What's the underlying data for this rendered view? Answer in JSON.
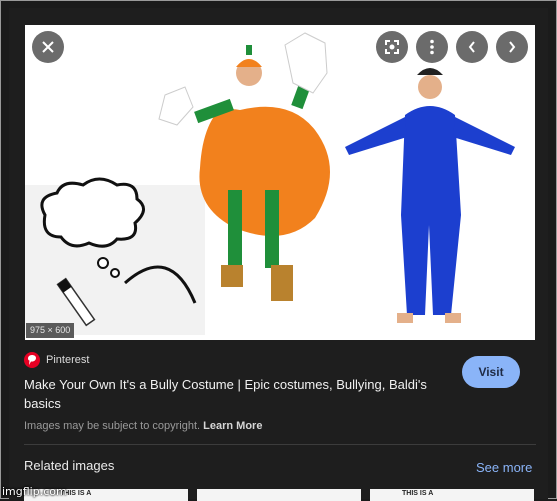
{
  "image": {
    "dimensions": "975 × 600"
  },
  "controls": {
    "close_icon": "close-icon",
    "lens_icon": "lens-icon",
    "more_icon": "more-vert-icon",
    "prev_icon": "chevron-left-icon",
    "next_icon": "chevron-right-icon"
  },
  "result": {
    "source": "Pinterest",
    "title": "Make Your Own It's a Bully Costume | Epic costumes, Bullying, Baldi's basics",
    "visit_label": "Visit",
    "copyright_text": "Images may be subject to copyright.",
    "learn_more": "Learn More"
  },
  "related": {
    "heading": "Related images",
    "see_more": "See more",
    "thumbs": [
      {
        "text": "THIS IS A"
      },
      {
        "text": ""
      },
      {
        "text": "THIS IS A"
      }
    ]
  },
  "watermark": "imgflip.com",
  "colors": {
    "background": "#1e1e1e",
    "accent": "#8ab4f8",
    "pinterest": "#e60023"
  }
}
